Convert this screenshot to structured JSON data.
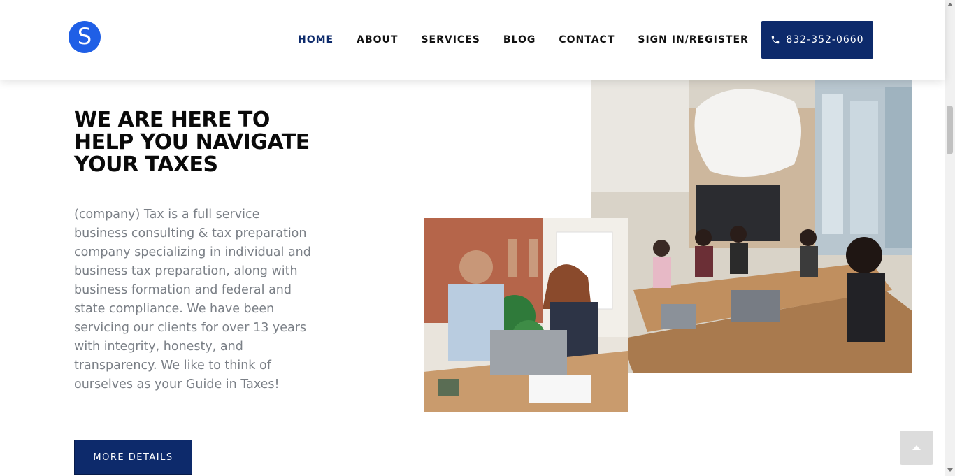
{
  "header": {
    "logo_letter": "S",
    "nav": [
      {
        "label": "HOME",
        "active": true
      },
      {
        "label": "ABOUT",
        "active": false
      },
      {
        "label": "SERVICES",
        "active": false
      },
      {
        "label": "BLOG",
        "active": false
      },
      {
        "label": "CONTACT",
        "active": false
      },
      {
        "label": "SIGN IN/REGISTER",
        "active": false
      }
    ],
    "phone": "832-352-0660",
    "phone_icon": "phone-icon"
  },
  "hero": {
    "title": "WE ARE HERE TO HELP YOU NAVIGATE YOUR TAXES",
    "description": "(company) Tax is a full service business consulting & tax preparation company specializing in individual and business tax preparation, along with business formation and federal and state compliance. We have been servicing our clients for over 13 years with integrity, honesty, and transparency. We like to think of ourselves as your Guide in Taxes!",
    "button_label": "MORE DETAILS"
  },
  "colors": {
    "brand_navy": "#0d2a6b",
    "logo_blue": "#1f5fe6",
    "body_text": "#7a7f86"
  }
}
